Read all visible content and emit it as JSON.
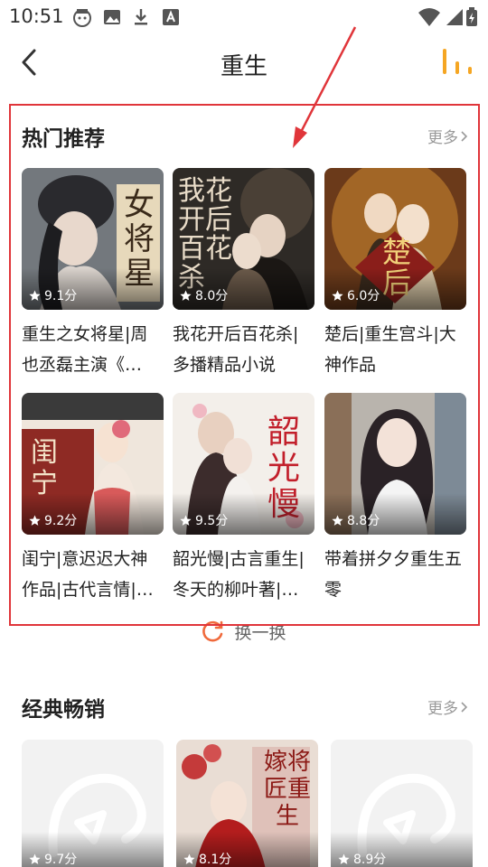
{
  "status_bar": {
    "time": "10:51"
  },
  "nav": {
    "title": "重生"
  },
  "hot": {
    "title": "热门推荐",
    "more": "更多",
    "refresh": "换一换",
    "books": [
      {
        "title": "重生之女将星|周也丞磊主演《…",
        "rating": "9.1分",
        "cover_text": "女将星"
      },
      {
        "title": "我花开后百花杀|多播精品小说",
        "rating": "8.0分",
        "cover_text": "我花开后百花杀"
      },
      {
        "title": "楚后|重生宫斗|大神作品",
        "rating": "6.0分",
        "cover_text": "楚后"
      },
      {
        "title": "闺宁|意迟迟大神作品|古代言情|…",
        "rating": "9.2分",
        "cover_text": "闺宁"
      },
      {
        "title": "韶光慢|古言重生|冬天的柳叶著|…",
        "rating": "9.5分",
        "cover_text": "韶光慢"
      },
      {
        "title": "带着拼夕夕重生五零",
        "rating": "8.8分",
        "cover_text": ""
      }
    ]
  },
  "classic": {
    "title": "经典畅销",
    "more": "更多",
    "books": [
      {
        "rating": "9.7分"
      },
      {
        "rating": "8.1分",
        "cover_text": "嫁将匠重生"
      },
      {
        "rating": "8.9分"
      }
    ]
  },
  "colors": {
    "accent": "#f5a623",
    "annotation": "#e0353a",
    "refresh_icon": "#f06a3c"
  }
}
